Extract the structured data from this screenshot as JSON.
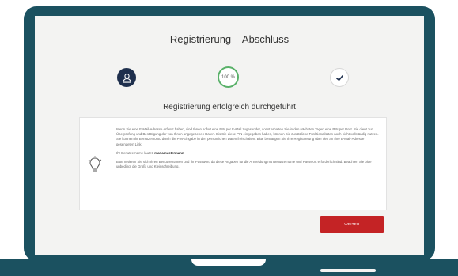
{
  "page": {
    "title": "Registrierung – Abschluss",
    "success_heading": "Registrierung erfolgreich durchgeführt"
  },
  "steps": [
    {
      "state": "done",
      "icon": "user-icon"
    },
    {
      "state": "current",
      "label": "100 %"
    },
    {
      "state": "complete",
      "icon": "check-icon"
    }
  ],
  "info": {
    "paragraph1": "Wenn Sie eine E-Mail-Adresse erfasst haben, sind Ihnen sofort eine PIN per E-Mail zugesendet, sonst erhalten Sie in den nächsten Tagen eine PIN per Post. Sie dient zur Überprüfung und Bestätigung der von Ihnen angegebenen Daten. Bis Sie diese PIN eingegeben haben, können Sie zusätzliche Funktionalitäten noch nicht vollständig nutzen. Sie können Ihr Benutzerkonto durch die PIN-Eingabe in den persönlichen Daten freischalten. Bitte bestätigen Sie Ihre Registrierung über den an Ihre E-Mail-Adresse gesendeten Link.",
    "username_prefix": "Ihr Benutzername lautet:",
    "username": "mariamustermann",
    "paragraph3": "Bitte notieren Sie sich Ihren Benutzernamen und Ihr Passwort, da diese Angaben für die Anmeldung mit Benutzername und Passwort erforderlich sind. Beachten Sie bitte unbedingt die Groß- und Kleinschreibung."
  },
  "actions": {
    "weiter_label": "WEITER"
  },
  "colors": {
    "frame": "#1b5160",
    "step_done": "#1e2f4d",
    "progress_ring": "#5ab16a",
    "button": "#c42325"
  }
}
